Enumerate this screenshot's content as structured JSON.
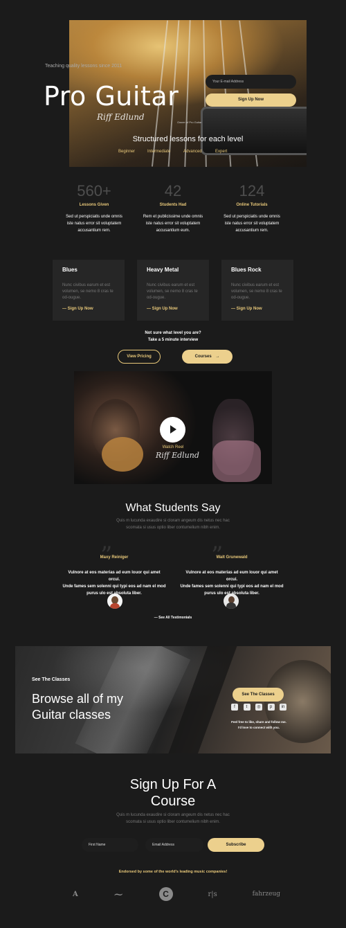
{
  "hero": {
    "tagline": "Teaching quality lessons since 2011",
    "title": "Pro Guitar",
    "signature": "Riff Edlund",
    "signature_caption": "Owner of Pro Guitar",
    "email_placeholder": "Your E-mail Address",
    "signup_label": "Sign Up Now",
    "subtitle": "Structured lessons for each level",
    "levels": [
      "Beginner",
      "Intermediate",
      "Advanced",
      "Expert"
    ]
  },
  "stats": [
    {
      "value": "560+",
      "label": "Lessons Given",
      "text": "Sed ut perspiciatis unde omnis iste natus error sit voluptatem accusantium rem."
    },
    {
      "value": "42",
      "label": "Students Had",
      "text": "Rem et publicissime unde omnis iste natus error sit voluptatem accusantium eum."
    },
    {
      "value": "124",
      "label": "Online Tutorials",
      "text": "Sed ut perspiciatis unde omnis iste natus error sit voluptatem accusantium rem."
    }
  ],
  "genres": [
    {
      "title": "Blues",
      "text": "Nunc civibus earum et est volumen, se nemo 8 cras te od-ougue.",
      "link": "— Sign Up Now"
    },
    {
      "title": "Heavy Metal",
      "text": "Nunc civibus earum et est volumen, se nemo 8 cras te od-ougue.",
      "link": "— Sign Up Now"
    },
    {
      "title": "Blues Rock",
      "text": "Nunc civibus earum et est volumen, se nemo 8 cras te od-ougue.",
      "link": "— Sign Up Now"
    }
  ],
  "level_prompt": {
    "line1": "Not sure what level you are?",
    "line2": "Take a 5 minute interview"
  },
  "cta": {
    "pricing": "View Pricing",
    "courses": "Courses"
  },
  "video": {
    "label": "Watch Reel"
  },
  "testimonials": {
    "title": "What Students Say",
    "intro1": "Quis m lucunda exaudire si cloram angeum dis netus nec hac",
    "intro2": "scomata si usus optio liber contumelium nibh enim.",
    "items": [
      {
        "name": "Maxy Reiniger",
        "line1": "Vulnore at eos materias ad eum louor qui amet orcui.",
        "line2": "Unde fames sem solenni qui typi eos ad nam el mod",
        "line3": "purus ulo est absoluta liber."
      },
      {
        "name": "Walt Grunewald",
        "line1": "Vulnore at eos materias ad eum louor qui amet orcui.",
        "line2": "Unde fames sem solenni qui typi eos ad nam el mod",
        "line3": "purus ulo est absoluta liber."
      }
    ],
    "see_all": "— See All Testimonials"
  },
  "browse": {
    "kicker": "See The Classes",
    "title1": "Browse all of my",
    "title2": "Guitar classes",
    "button": "See The Classes",
    "follow1": "Feel free to like, share and follow me.",
    "follow2": "I'd love to connect with you.",
    "social": [
      "facebook-icon",
      "twitter-icon",
      "instagram-icon",
      "pinterest-icon",
      "linkedin-icon"
    ]
  },
  "signup": {
    "title1": "Sign Up For A",
    "title2": "Course",
    "intro1": "Quis m lucunda exaudire si cloram angeum dis netus nec hac",
    "intro2": "scomata si usus optio liber contumelium nibh enim.",
    "first_name": "First Name",
    "email": "Email Address",
    "button": "Subscribe",
    "endorsed": "Endorsed by some of the world's leading music companies!",
    "logos": [
      "A",
      "~",
      "C",
      "r|s",
      "fahrzeug"
    ]
  },
  "colors": {
    "background": "#1b1b1b",
    "accent": "#e9c97a",
    "button": "#ecd08d",
    "card": "#262626"
  }
}
